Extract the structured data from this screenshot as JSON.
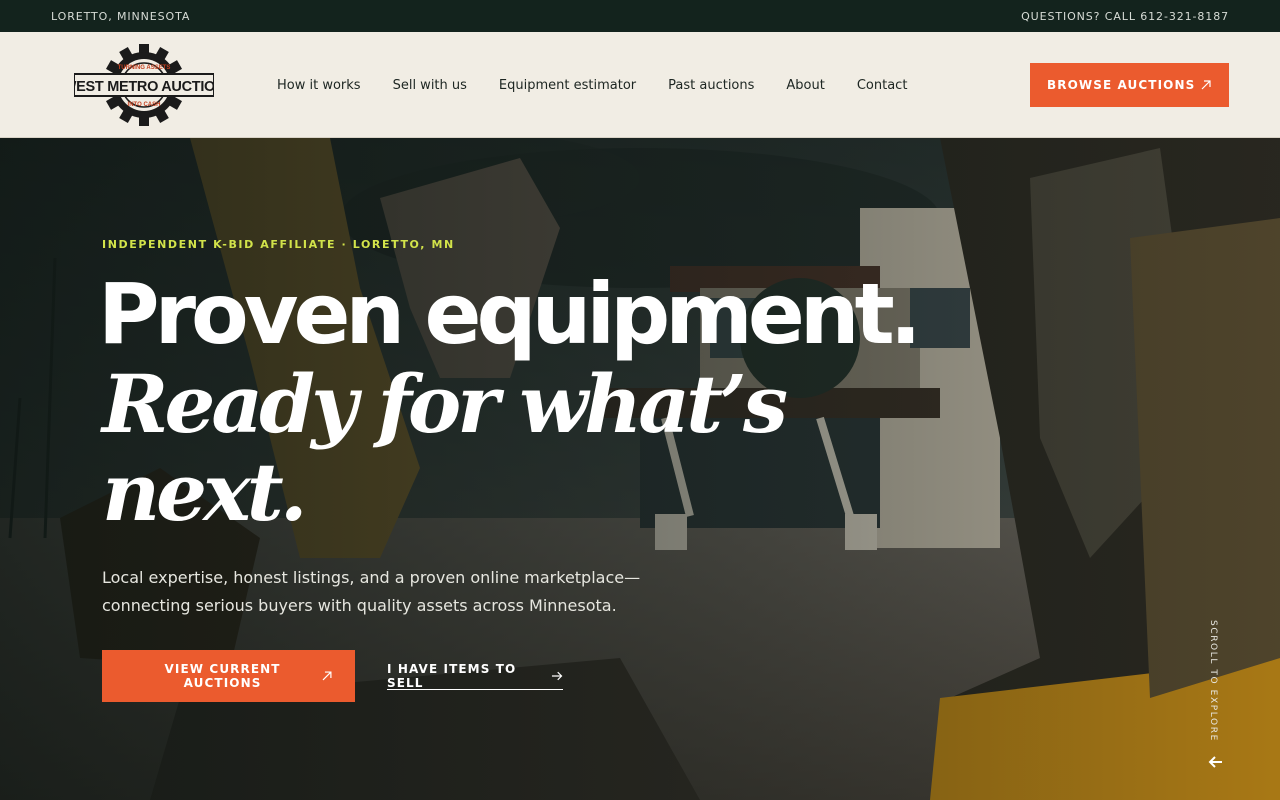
{
  "topbar": {
    "location": "LORETTO, MINNESOTA",
    "phone_text": "QUESTIONS? CALL 612-321-8187"
  },
  "logo": {
    "brand_name": "WEST METRO AUCTION",
    "tagline_top": "TURNING ASSETS",
    "tagline_bottom": "INTO CASH",
    "icon": "gear-icon"
  },
  "nav": {
    "items": [
      {
        "label": "How it works"
      },
      {
        "label": "Sell with us"
      },
      {
        "label": "Equipment estimator"
      },
      {
        "label": "Past auctions"
      },
      {
        "label": "About"
      },
      {
        "label": "Contact"
      }
    ],
    "cta_label": "BROWSE AUCTIONS",
    "cta_icon": "arrow-up-right-icon"
  },
  "hero": {
    "eyebrow": "INDEPENDENT K-BID AFFILIATE · LORETTO, MN",
    "headline_line1": "Proven equipment.",
    "headline_line2": "Ready for what’s next.",
    "lede": "Local expertise, honest listings, and a proven online marketplace—connecting serious buyers with quality assets across Minnesota.",
    "primary_cta": "VIEW CURRENT AUCTIONS",
    "primary_cta_icon": "arrow-up-right-icon",
    "secondary_cta": "I HAVE ITEMS TO SELL",
    "secondary_cta_icon": "arrow-right-icon",
    "scroll_hint": "SCROLL TO EXPLORE",
    "scroll_icon": "arrow-left-icon",
    "background_image": "excavator-construction-site-photo"
  },
  "colors": {
    "topbar_bg": "#13231d",
    "header_bg": "#f1ede4",
    "accent_orange": "#eb5b2e",
    "eyebrow_lime": "#d2e34a"
  }
}
